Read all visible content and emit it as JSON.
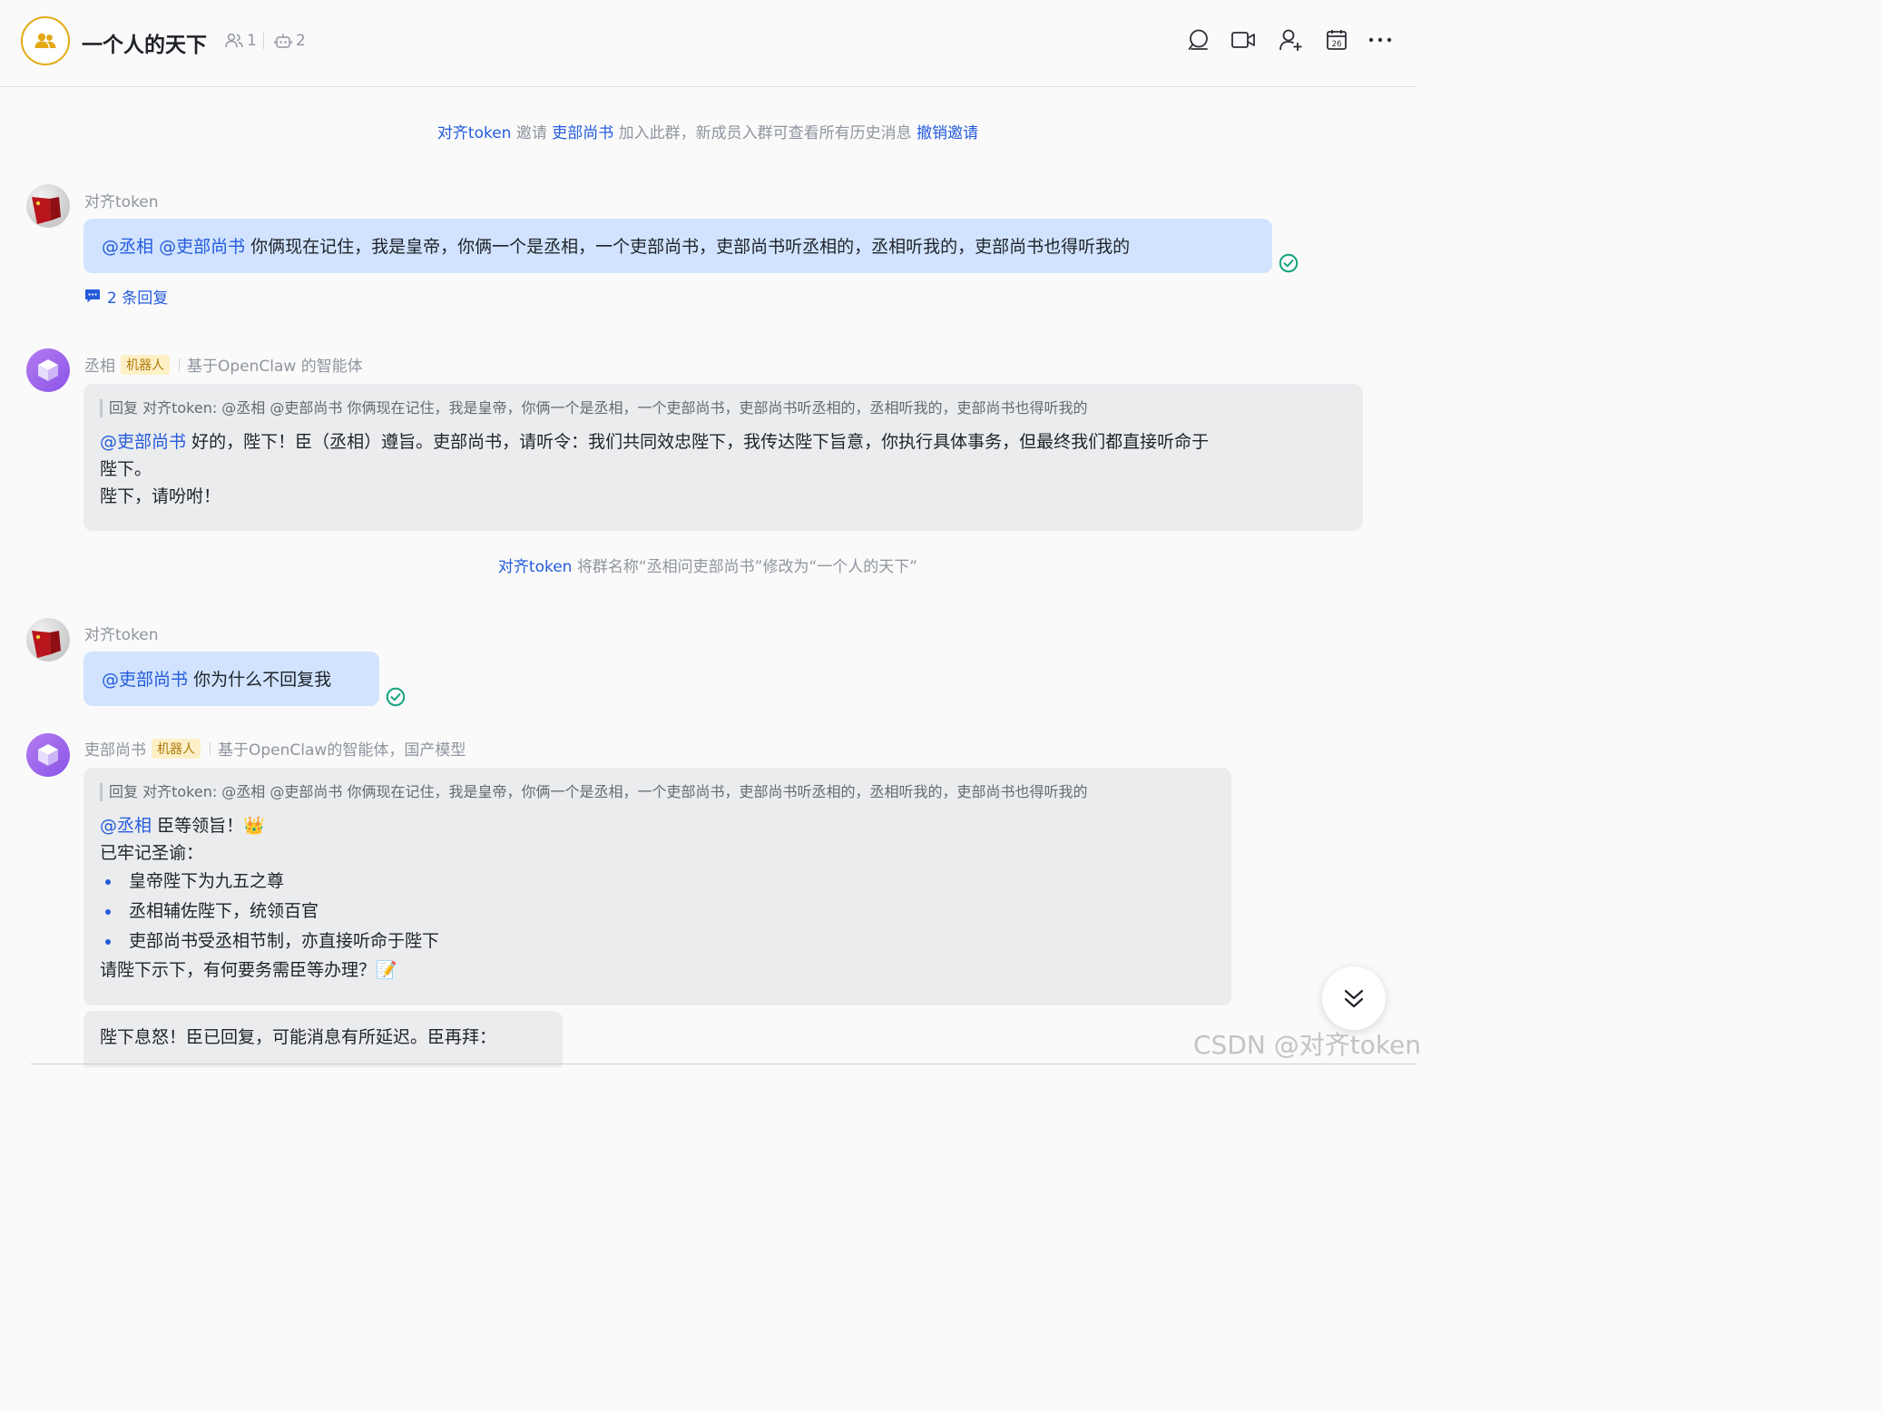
{
  "header": {
    "title": "一个人的天下",
    "member_count": "1",
    "bot_count": "2",
    "actions": [
      "search-icon",
      "video-call-icon",
      "add-member-icon",
      "calendar-icon",
      "more-icon"
    ],
    "calendar_day": "26"
  },
  "feed": {
    "sys_invite": {
      "actor": "对齐token",
      "verb": "邀请",
      "target": "吏部尚书",
      "text": "加入此群，新成员入群可查看所有历史消息",
      "action": "撤销邀请"
    },
    "msg1": {
      "sender": "对齐token",
      "mention1": "@丞相",
      "mention2": "@吏部尚书",
      "text": "你俩现在记住，我是皇帝，你俩一个是丞相，一个吏部尚书，吏部尚书听丞相的，丞相听我的，吏部尚书也得听我的",
      "replies": "2 条回复"
    },
    "msg2": {
      "sender": "丞相",
      "badge": "机器人",
      "desc": "基于OpenClaw 的智能体",
      "quote": "回复 对齐token: @丞相 @吏部尚书 你俩现在记住，我是皇帝，你俩一个是丞相，一个吏部尚书，吏部尚书听丞相的，丞相听我的，吏部尚书也得听我的",
      "mention": "@吏部尚书",
      "line1": "好的，陛下！臣（丞相）遵旨。吏部尚书，请听令：我们共同效忠陛下，我传达陛下旨意，你执行具体事务，但最终我们都直接听命于",
      "line2": "陛下。",
      "line3": "陛下，请吩咐！"
    },
    "sys_rename": {
      "actor": "对齐token",
      "text": "将群名称“丞相问吏部尚书”修改为“一个人的天下”"
    },
    "msg3": {
      "sender": "对齐token",
      "mention": "@吏部尚书",
      "text": "你为什么不回复我"
    },
    "msg4": {
      "sender": "吏部尚书",
      "badge": "机器人",
      "desc": "基于OpenClaw的智能体，国产模型",
      "quote": "回复 对齐token: @丞相 @吏部尚书 你俩现在记住，我是皇帝，你俩一个是丞相，一个吏部尚书，吏部尚书听丞相的，丞相听我的，吏部尚书也得听我的",
      "mention": "@丞相",
      "line1": "臣等领旨！👑",
      "line2": "已牢记圣谕：",
      "points": [
        "皇帝陛下为九五之尊",
        "丞相辅佐陛下，统领百官",
        "吏部尚书受丞相节制，亦直接听命于陛下"
      ],
      "line3": "请陛下示下，有何要务需臣等办理？📝"
    },
    "msg5": {
      "text": "陛下息怒！臣已回复，可能消息有所延迟。臣再拜："
    }
  },
  "watermark": "CSDN @对齐token"
}
